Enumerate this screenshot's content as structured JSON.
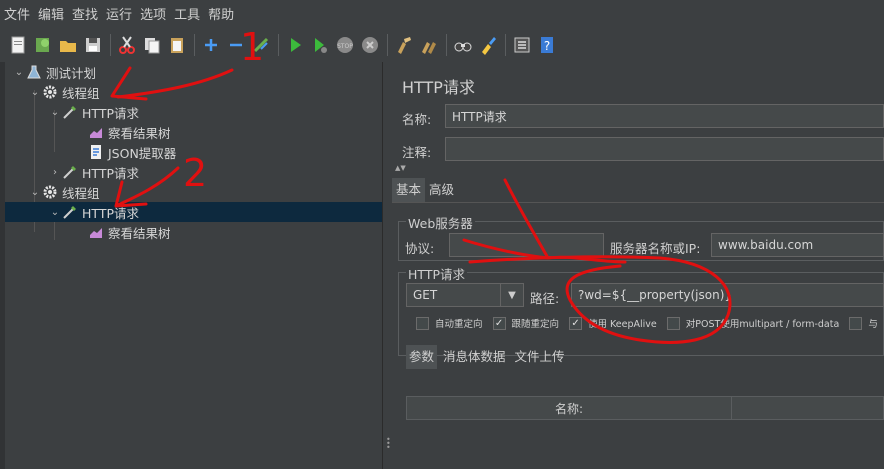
{
  "menu": [
    "文件",
    "编辑",
    "查找",
    "运行",
    "选项",
    "工具",
    "帮助"
  ],
  "toolbar_icons": [
    "new-icon",
    "templates-icon",
    "open-icon",
    "save-icon",
    "cut-icon",
    "copy-icon",
    "paste-icon",
    "expand-icon",
    "collapse-icon",
    "toggle-icon",
    "start-icon",
    "start-no-pause-icon",
    "stop-icon",
    "shutdown-icon",
    "clear-icon",
    "clear-all-icon",
    "search-icon",
    "reset-search-icon",
    "function-helper-icon",
    "help-icon"
  ],
  "tree": [
    {
      "label": "测试计划",
      "icon": "test-plan-icon",
      "arrow": "▼",
      "x": 8
    },
    {
      "label": "线程组",
      "icon": "gear-icon",
      "arrow": "▼",
      "x": 24
    },
    {
      "label": "HTTP请求",
      "icon": "pipette-icon",
      "arrow": "▼",
      "x": 44
    },
    {
      "label": "察看结果树",
      "icon": "chart-icon",
      "arrow": "",
      "x": 70
    },
    {
      "label": "JSON提取器",
      "icon": "document-icon",
      "arrow": "",
      "x": 70
    },
    {
      "label": "HTTP请求",
      "icon": "pipette-icon",
      "arrow": "▶",
      "x": 44
    },
    {
      "label": "线程组",
      "icon": "gear-icon",
      "arrow": "▼",
      "x": 24
    },
    {
      "label": "HTTP请求",
      "icon": "pipette-icon",
      "arrow": "▼",
      "x": 44,
      "selected": true
    },
    {
      "label": "察看结果树",
      "icon": "chart-icon",
      "arrow": "",
      "x": 70
    }
  ],
  "panel": {
    "title": "HTTP请求",
    "name_label": "名称:",
    "name_value": "HTTP请求",
    "comment_label": "注释:",
    "comment_value": "",
    "tabs": [
      "基本",
      "高级"
    ],
    "web_server_title": "Web服务器",
    "protocol_label": "协议:",
    "protocol_value": "",
    "server_label": "服务器名称或IP:",
    "server_value": "www.baidu.com",
    "http_request_title": "HTTP请求",
    "method": "GET",
    "path_label": "路径:",
    "path_value": "?wd=${__property(json)}",
    "checkboxes": [
      {
        "label": "自动重定向",
        "checked": false
      },
      {
        "label": "跟随重定向",
        "checked": true
      },
      {
        "label": "使用 KeepAlive",
        "checked": true
      },
      {
        "label": "对POST使用multipart / form-data",
        "checked": false
      },
      {
        "label": "与",
        "checked": false
      }
    ],
    "subtabs": [
      "参数",
      "消息体数据",
      "文件上传"
    ],
    "table_header_name": "名称:"
  },
  "annotations": {
    "label_1": "1",
    "label_2": "2"
  },
  "colors": {
    "background": "#3c3f41",
    "selection": "#0d293e",
    "annotation": "#e01010"
  }
}
